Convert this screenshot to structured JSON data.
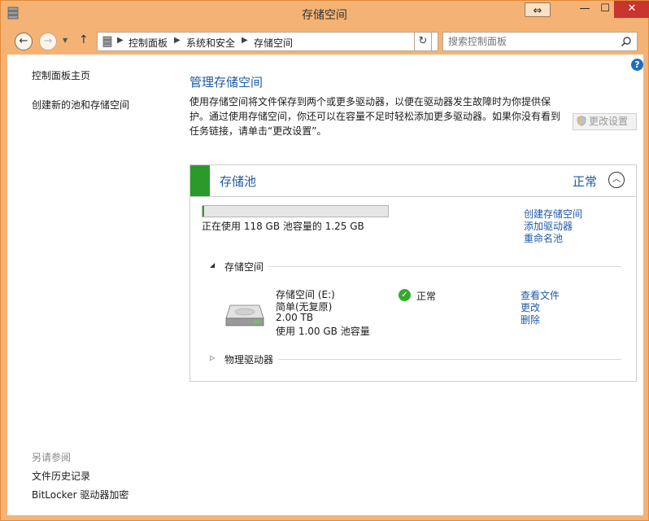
{
  "window": {
    "title": "存储空间",
    "controls": {
      "snap": "⇔",
      "minimize": "—",
      "maximize": "☐",
      "close": "✕"
    }
  },
  "nav": {
    "back": "←",
    "forward": "→",
    "recent": "▼",
    "up": "↑",
    "breadcrumbs": [
      "控制面板",
      "系统和安全",
      "存储空间"
    ],
    "separator": "▶",
    "refresh": "↻",
    "search_placeholder": "搜索控制面板"
  },
  "help": {
    "label": "?"
  },
  "sidebar": {
    "items": [
      "控制面板主页",
      "创建新的池和存储空间"
    ],
    "see_also_heading": "另请参阅",
    "see_also": [
      "文件历史记录",
      "BitLocker 驱动器加密"
    ]
  },
  "main": {
    "title": "管理存储空间",
    "description": "使用存储空间将文件保存到两个或更多驱动器，以便在驱动器发生故障时为你提供保护。通过使用存储空间，你还可以在容量不足时轻松添加更多驱动器。如果你没有看到任务链接，请单击“更改设置”。",
    "change_settings": "更改设置"
  },
  "pool": {
    "title": "存储池",
    "status": "正常",
    "collapse": "︿",
    "usage_fraction": 0.01,
    "usage_text": "正在使用 118 GB 池容量的 1.25 GB",
    "links": [
      "创建存储空间",
      "添加驱动器",
      "重命名池"
    ],
    "spaces_section": "存储空间",
    "spaces_toggle": "◢",
    "space": {
      "name": "存储空间 (E:)",
      "layout": "简单(无复原)",
      "size": "2.00 TB",
      "usage": "使用 1.00 GB 池容量",
      "status": "正常",
      "status_icon": "✓",
      "links": [
        "查看文件",
        "更改",
        "删除"
      ]
    },
    "drives_section": "物理驱动器",
    "drives_toggle": "▷"
  },
  "colors": {
    "accent_green": "#2a9a2a",
    "link_blue": "#1e5aa8",
    "frame": "#f4b374",
    "close_red": "#c7352e"
  }
}
